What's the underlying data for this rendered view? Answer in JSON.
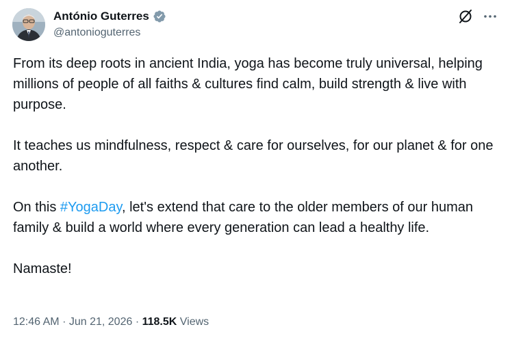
{
  "author": {
    "display_name": "António Guterres",
    "handle": "@antonioguterres",
    "verified": true
  },
  "tweet": {
    "para1": "From its deep roots in ancient India, yoga has become truly universal, helping millions of people of all faiths & cultures find calm, build strength & live with purpose.",
    "para2": "It teaches us mindfulness, respect & care for ourselves, for our planet & for one another.",
    "para3_before": "On this ",
    "hashtag": "#YogaDay",
    "para3_after": ", let's extend that care to the older members of our human family & build a world where every generation can lead a healthy life.",
    "para4": "Namaste!"
  },
  "meta": {
    "time": "12:46 AM",
    "date": "Jun 21, 2026",
    "separator": "·",
    "views_count": "118.5K",
    "views_label": "Views"
  },
  "colors": {
    "text": "#0f1419",
    "secondary": "#536471",
    "accent": "#1d9bf0"
  },
  "icons": {
    "verified": "verified-badge-icon",
    "grok": "grok-icon",
    "more": "more-options-icon"
  }
}
